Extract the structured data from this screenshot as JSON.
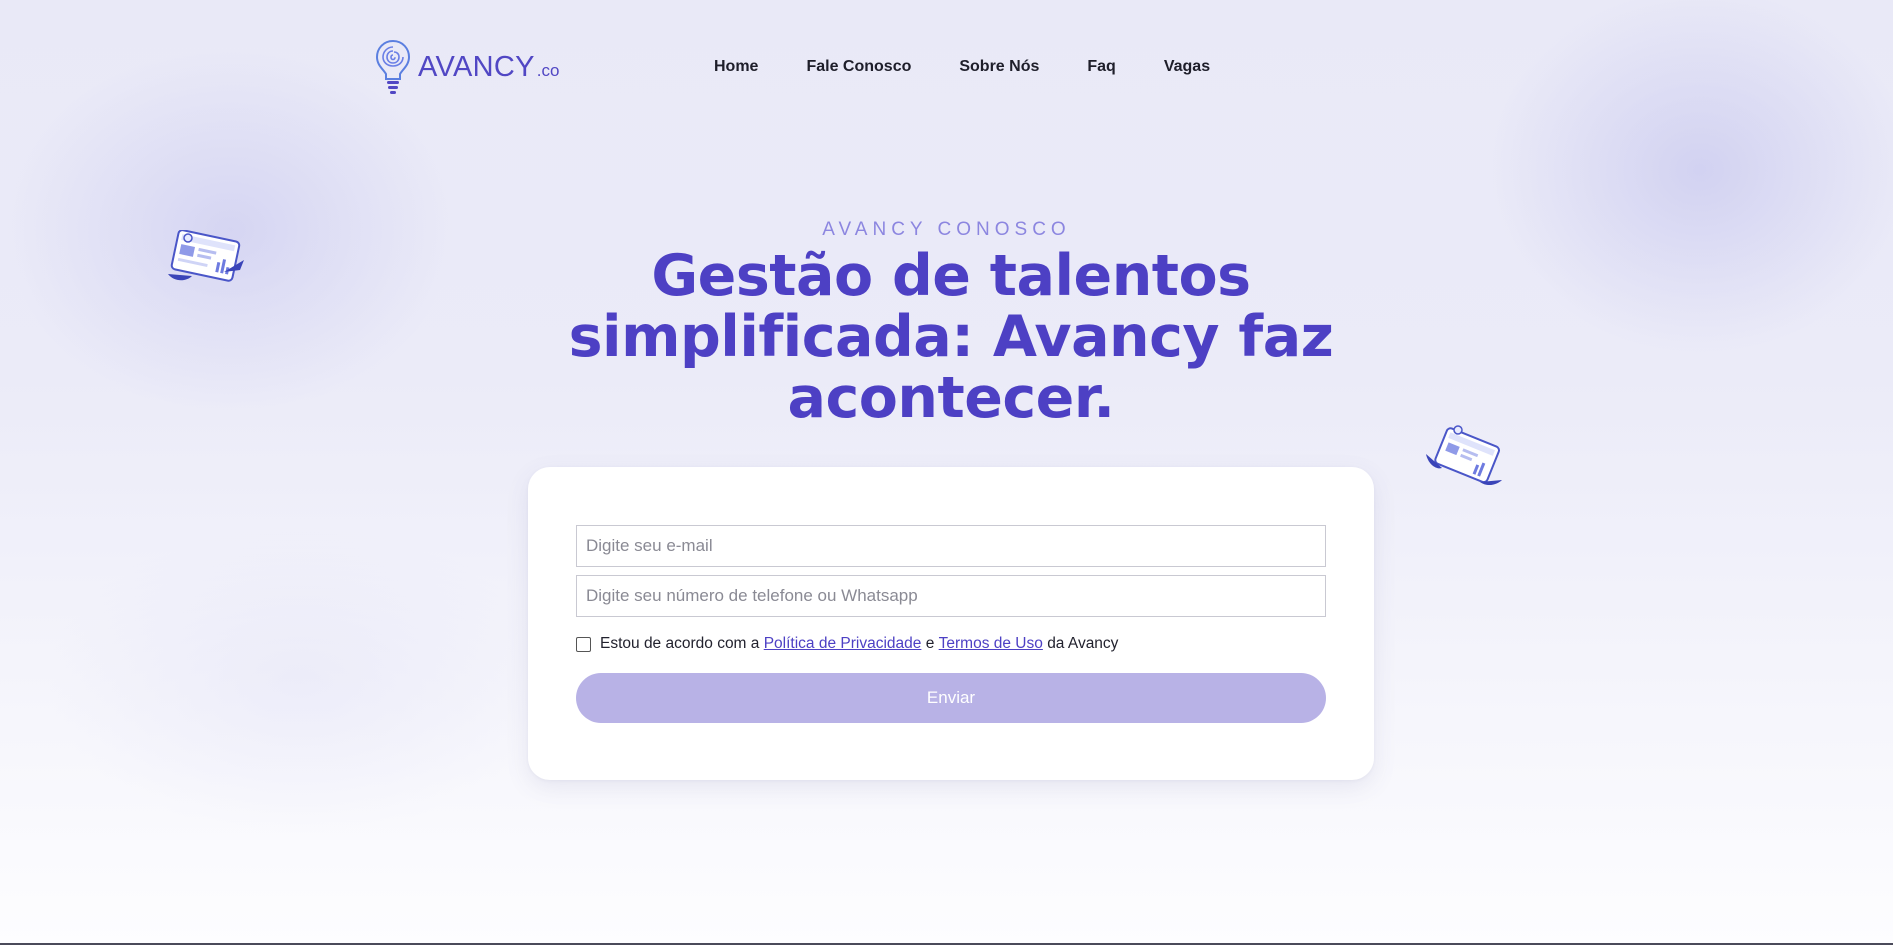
{
  "header": {
    "logo": {
      "brand": "AVANCY",
      "suffix": ".co"
    },
    "nav": [
      {
        "label": "Home"
      },
      {
        "label": "Fale Conosco"
      },
      {
        "label": "Sobre Nós"
      },
      {
        "label": "Faq"
      },
      {
        "label": "Vagas"
      }
    ]
  },
  "hero": {
    "eyebrow": "AVANCY CONOSCO",
    "title": "Gestão de talentos simplificada: Avancy faz acontecer."
  },
  "form": {
    "email_placeholder": "Digite seu e-mail",
    "phone_placeholder": "Digite seu número de telefone ou Whatsapp",
    "consent": {
      "prefix": "Estou de acordo com a",
      "privacy_link": "Política de Privacidade",
      "conjunction": "e",
      "terms_link": "Termos de Uso",
      "suffix": "da Avancy",
      "checked": false
    },
    "submit_label": "Enviar"
  },
  "colors": {
    "brand": "#4d40c4",
    "eyebrow": "#8c86e0",
    "button_disabled": "#b8b2e6"
  },
  "icons": [
    "lightbulb-logo-icon",
    "dashboard-illustration-icon"
  ]
}
